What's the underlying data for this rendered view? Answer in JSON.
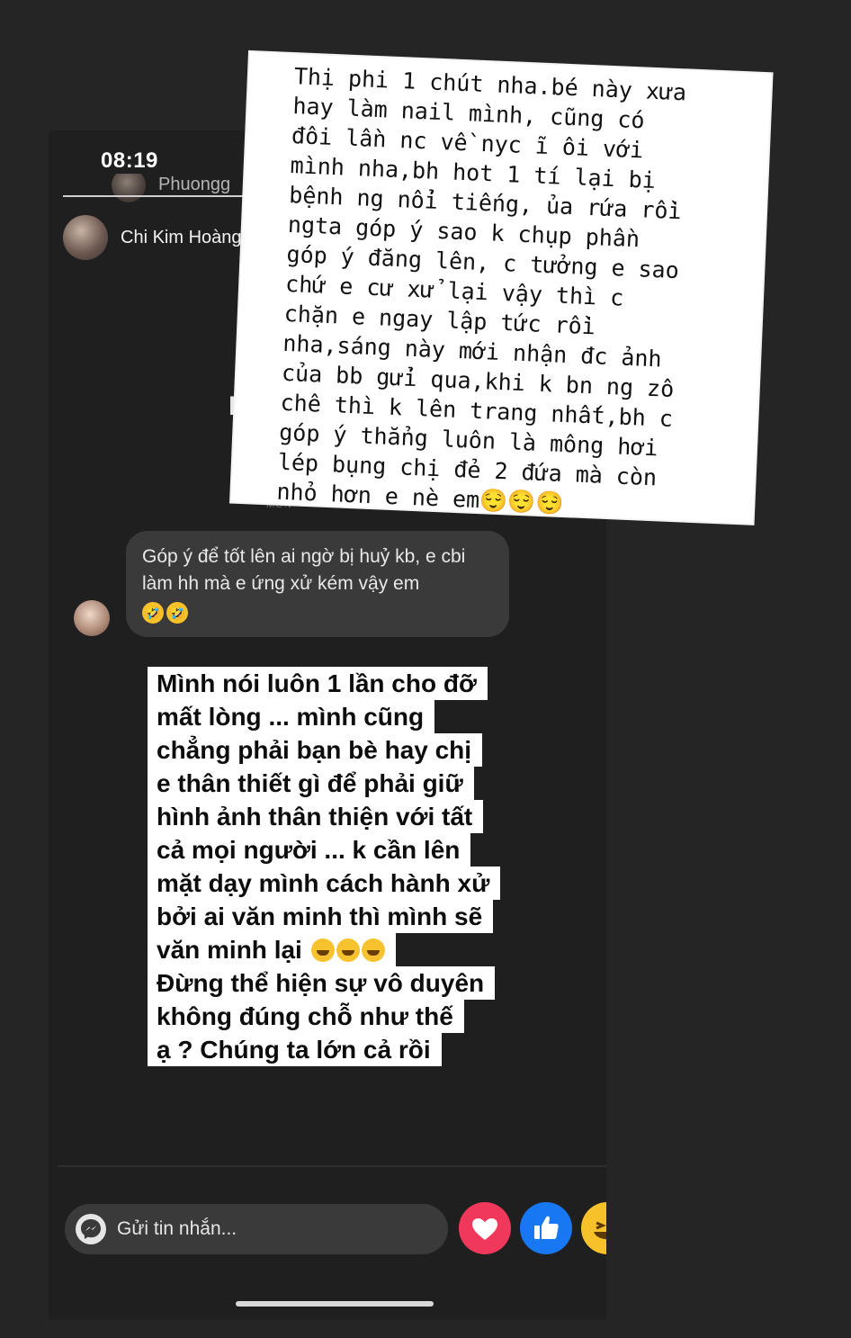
{
  "status_bar": {
    "time": "08:19"
  },
  "viewers": {
    "top_name": "Phuongg",
    "main_name": "Chi Kim Hoàng 6"
  },
  "background": {
    "partial_letter": "P",
    "tiny_text": "MON"
  },
  "note_sticker": {
    "text": "Thị phi 1 chút nha.bé này xưa\nhay làm nail mình, cũng có\nđôi lần nc về nyc ĩ ôi với\nmình nha,bh hot 1 tí lại bị\nbệnh ng nổi tiếng, ủa rứa rồi\nngta góp ý sao k chụp phần\ngóp ý đăng lên, c tưởng e sao\nchứ e cư xử lại vậy thì c\nchặn e ngay lập tức rồi\nnha,sáng này mới nhận đc ảnh\ncủa bb gửi qua,khi k bn ng zô\nchê thì k lên trang nhất,bh c\ngóp ý thẳng luôn là mông hơi\nlép bụng chị đẻ 2 đứa mà còn\nnhỏ hơn e nè em😌😌😌"
  },
  "chat": {
    "message": "Góp ý để tốt lên ai ngờ bị huỷ kb, e cbi làm hh mà e ứng xử kém vậy em",
    "emoji_1": "🤣",
    "emoji_2": "🤣"
  },
  "reply_sticker": {
    "lines": [
      "Mình nói luôn 1 lần cho đỡ",
      "mất lòng ... mình cũng",
      "chẳng phải bạn bè hay chị",
      "e thân thiết gì để phải giữ",
      "hình ảnh thân thiện với tất",
      "cả mọi người ... k cần lên",
      "mặt dạy mình cách hành xử",
      "bởi ai văn minh thì mình sẽ",
      "văn minh lại",
      "Đừng thể hiện sự vô duyên",
      "không đúng chỗ như thế",
      "ạ ? Chúng ta lớn cả rồi"
    ]
  },
  "composer": {
    "placeholder": "Gửi tin nhắn..."
  },
  "icons": {
    "messenger": "messenger-icon",
    "heart": "heart-icon",
    "like": "thumbs-up-icon",
    "laugh": "laugh-icon"
  },
  "colors": {
    "background": "#252525",
    "panel": "#1f1f1f",
    "bubble": "#3a3a3a",
    "heart": "#f0385b",
    "like": "#1877f2",
    "laugh": "#f7c12a"
  }
}
